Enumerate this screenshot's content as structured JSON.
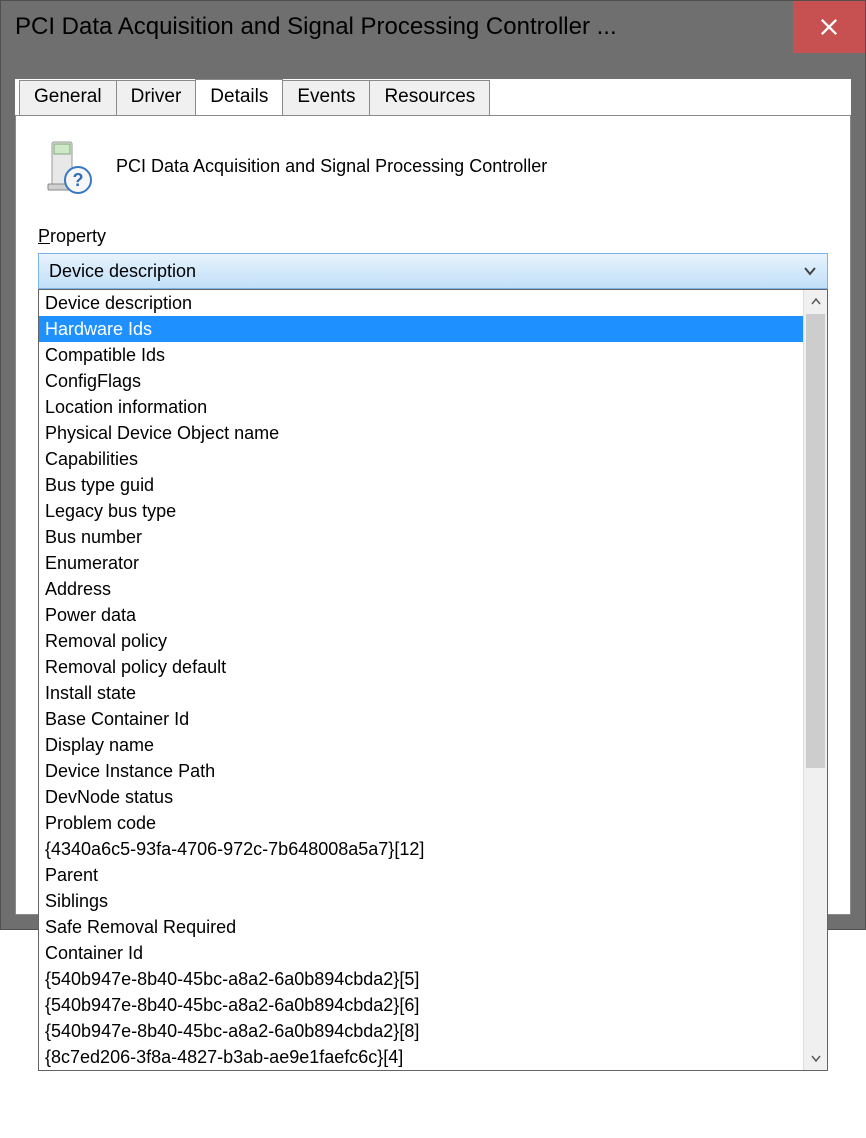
{
  "window": {
    "title": "PCI Data Acquisition and Signal Processing Controller ..."
  },
  "tabs": [
    {
      "label": "General"
    },
    {
      "label": "Driver"
    },
    {
      "label": "Details"
    },
    {
      "label": "Events"
    },
    {
      "label": "Resources"
    }
  ],
  "device": {
    "name": "PCI Data Acquisition and Signal Processing Controller"
  },
  "property_label_prefix": "P",
  "property_label_rest": "roperty",
  "combo": {
    "selected": "Device description"
  },
  "dropdown_items": [
    "Device description",
    "Hardware Ids",
    "Compatible Ids",
    "ConfigFlags",
    "Location information",
    "Physical Device Object name",
    "Capabilities",
    "Bus type guid",
    "Legacy bus type",
    "Bus number",
    "Enumerator",
    "Address",
    "Power data",
    "Removal policy",
    "Removal policy default",
    "Install state",
    "Base Container Id",
    "Display name",
    "Device Instance Path",
    "DevNode status",
    "Problem code",
    "{4340a6c5-93fa-4706-972c-7b648008a5a7}[12]",
    "Parent",
    "Siblings",
    "Safe Removal Required",
    "Container Id",
    "{540b947e-8b40-45bc-a8a2-6a0b894cbda2}[5]",
    "{540b947e-8b40-45bc-a8a2-6a0b894cbda2}[6]",
    "{540b947e-8b40-45bc-a8a2-6a0b894cbda2}[8]",
    "{8c7ed206-3f8a-4827-b3ab-ae9e1faefc6c}[4]"
  ],
  "highlight_index": 1
}
